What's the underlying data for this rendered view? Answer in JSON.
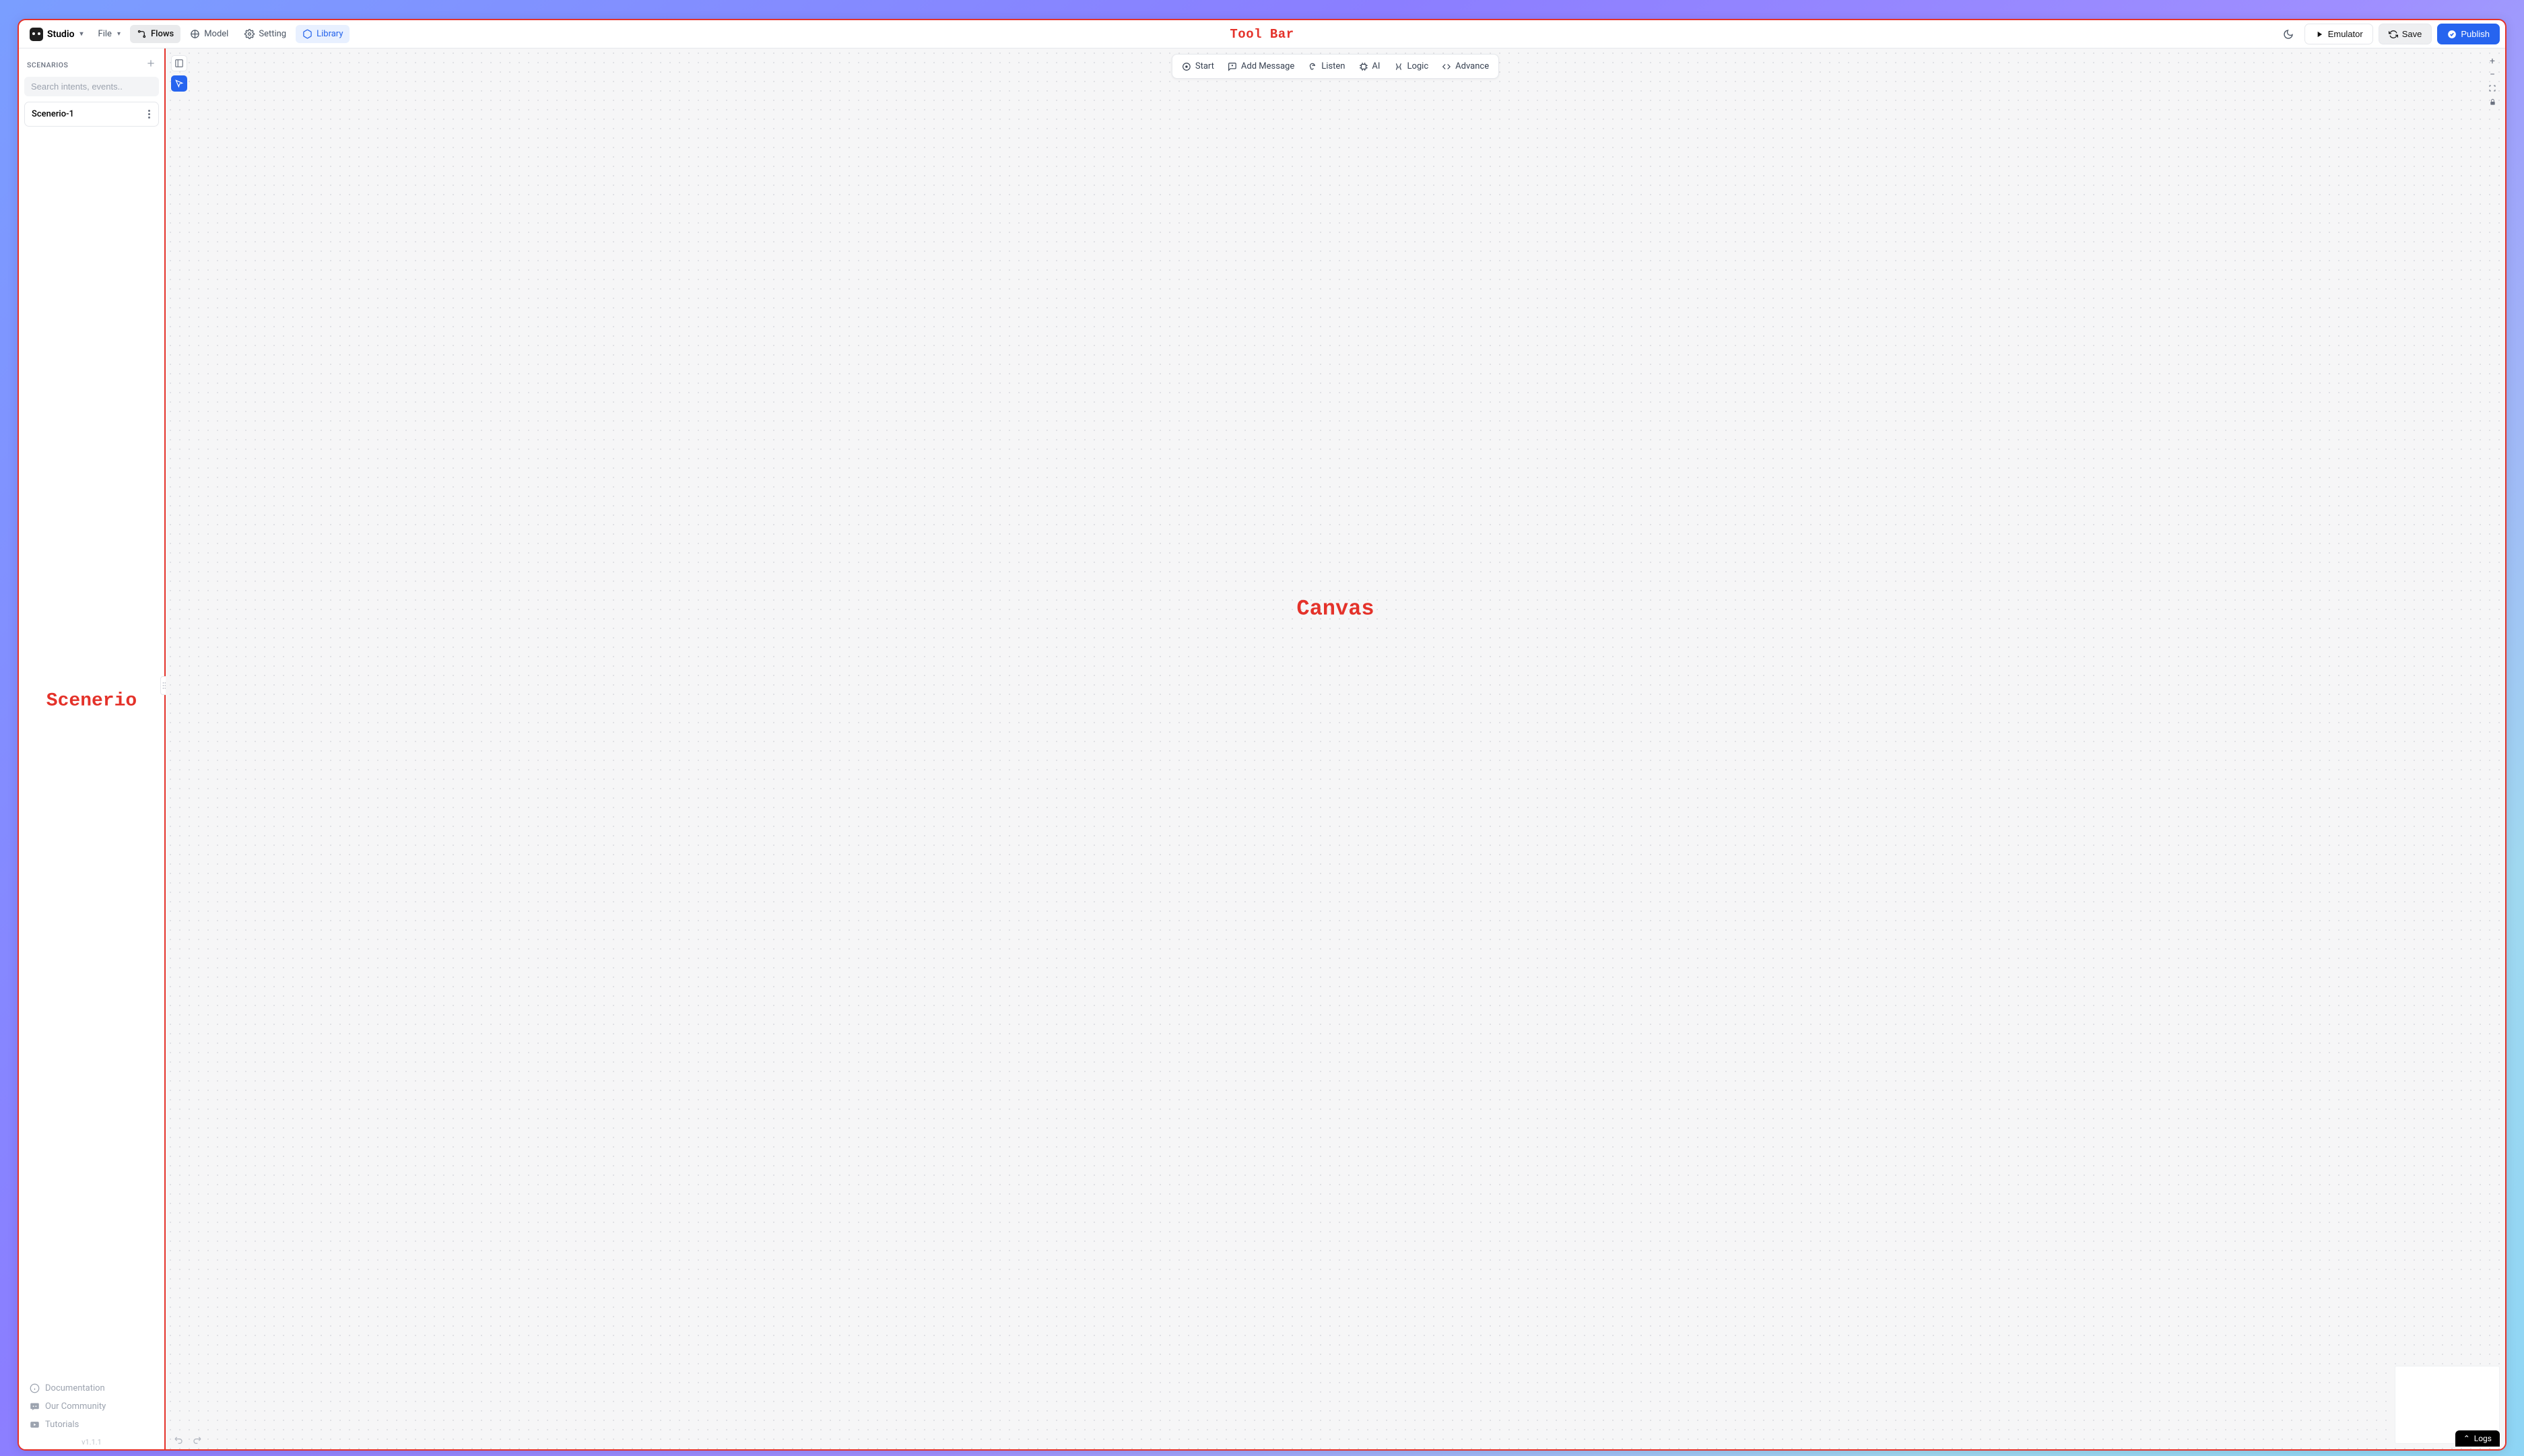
{
  "brand": {
    "name": "Studio"
  },
  "toolbar": {
    "file": "File",
    "items": [
      {
        "key": "flows",
        "label": "Flows",
        "active": true
      },
      {
        "key": "model",
        "label": "Model"
      },
      {
        "key": "setting",
        "label": "Setting"
      },
      {
        "key": "library",
        "label": "Library",
        "variant": "library"
      }
    ],
    "emulator": "Emulator",
    "save": "Save",
    "publish": "Publish",
    "annotation": "Tool Bar"
  },
  "sidebar": {
    "title": "SCENARIOS",
    "search_placeholder": "Search intents, events..",
    "scenarios": [
      {
        "name": "Scenerio-1"
      }
    ],
    "annotation": "Scenerio",
    "links": {
      "documentation": "Documentation",
      "community": "Our Community",
      "tutorials": "Tutorials"
    },
    "version": "v1.1.1"
  },
  "canvas": {
    "annotation": "Canvas",
    "nodes": {
      "start": "Start",
      "add_message": "Add Message",
      "listen": "Listen",
      "ai": "AI",
      "logic": "Logic",
      "advance": "Advance"
    },
    "logs": "Logs"
  }
}
